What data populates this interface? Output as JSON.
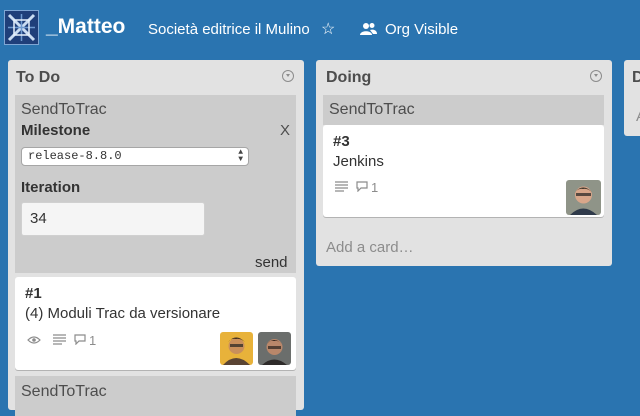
{
  "header": {
    "board_name": "_Matteo",
    "org_name": "Società editrice il Mulino",
    "star": "☆",
    "visibility": "Org Visible"
  },
  "lists": [
    {
      "title": "To Do",
      "plugin": {
        "title": "SendToTrac",
        "milestone_label": "Milestone",
        "close": "X",
        "milestone_selected": "release-8.8.0",
        "iteration_label": "Iteration",
        "iteration_value": "34",
        "send": "send"
      },
      "cards": [
        {
          "number": "#1",
          "title": "(4) Moduli Trac da versionare",
          "comments": "1"
        }
      ],
      "next_plugin_title": "SendToTrac"
    },
    {
      "title": "Doing",
      "plugin": {
        "title": "SendToTrac"
      },
      "cards": [
        {
          "number": "#3",
          "title": "Jenkins",
          "comments": "1"
        }
      ],
      "add_card": "Add a card…"
    },
    {
      "title": "D",
      "add_card": "A"
    }
  ],
  "colors": {
    "board_bg": "#2a74b0",
    "list_bg": "#e2e2e2",
    "plugin_bg": "#cccccc"
  }
}
